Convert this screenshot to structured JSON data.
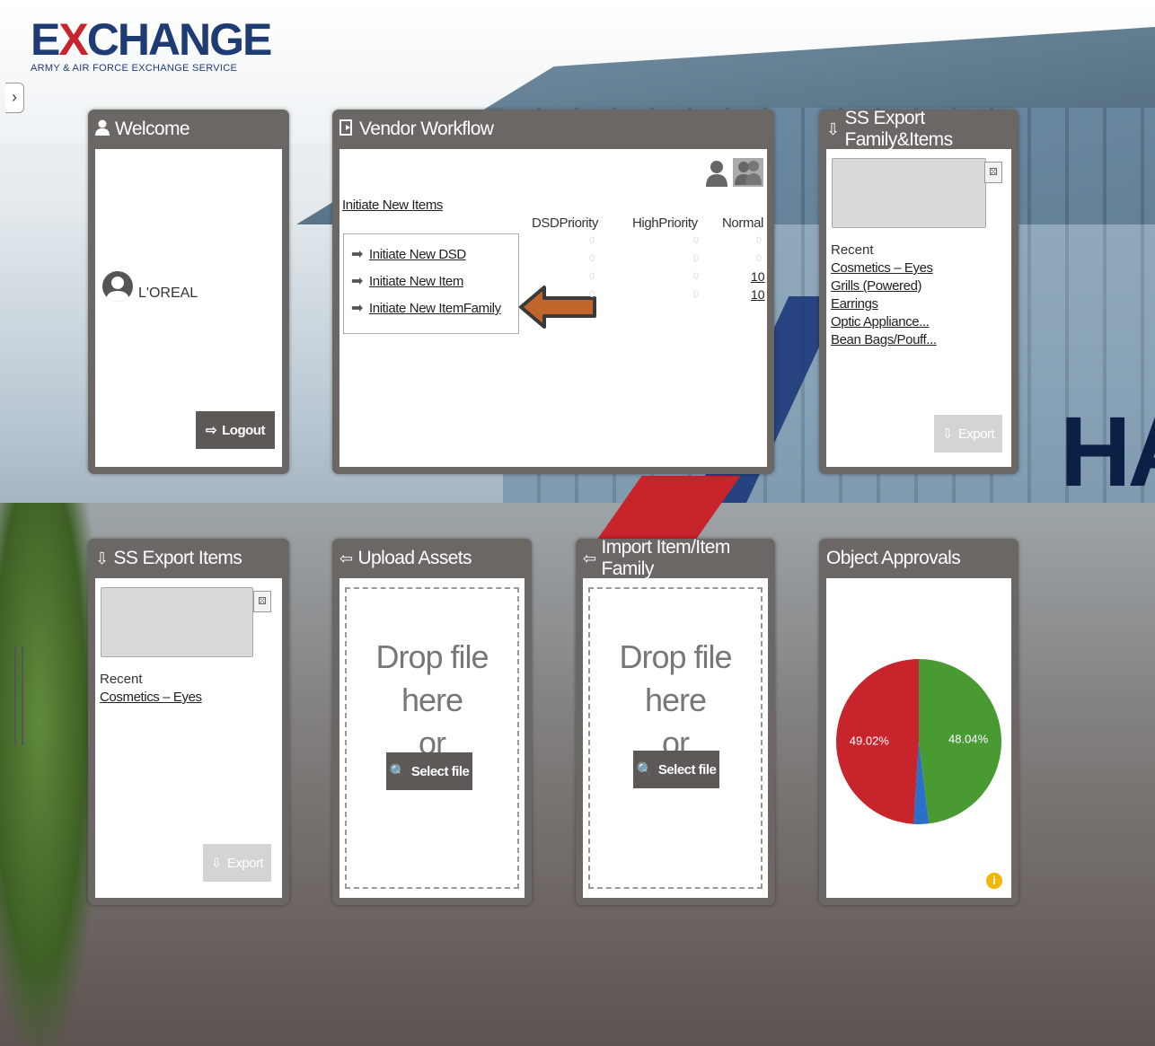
{
  "logo": {
    "title_a": "E",
    "title_x": "X",
    "title_b": "CHANGE",
    "subtitle": "ARMY & AIR FORCE EXCHANGE SERVICE"
  },
  "sidebar_toggle": "›",
  "welcome": {
    "title": "Welcome",
    "user": "L'OREAL",
    "logout": "Logout"
  },
  "workflow": {
    "title": "Vendor Workflow",
    "initiate_label": "Initiate New Items",
    "menu": [
      "Initiate  New  DSD",
      "Initiate  New  Item",
      "Initiate  New  ItemFamily"
    ],
    "columns": [
      "DSDPriority",
      "HighPriority",
      "Normal"
    ],
    "zero": "0",
    "normal_values": [
      "10",
      "10"
    ]
  },
  "ss_family": {
    "title": "SS Export Family&Items",
    "recent_label": "Recent",
    "recent": [
      "Cosmetics – Eyes",
      "Grills (Powered)",
      "Earrings",
      "Optic Appliance...",
      "Bean Bags/Pouff..."
    ],
    "export": "Export"
  },
  "ss_items": {
    "title": "SS Export Items",
    "recent_label": "Recent",
    "recent": [
      "Cosmetics – Eyes"
    ],
    "export": "Export"
  },
  "upload": {
    "title": "Upload Assets",
    "drop1": "Drop file here",
    "drop2": "or",
    "select": "Select file"
  },
  "import": {
    "title": "Import Item/Item Family",
    "drop1": "Drop file here",
    "drop2": "or",
    "select": "Select file"
  },
  "approvals": {
    "title": "Object Approvals",
    "info": "i"
  },
  "chart_data": {
    "type": "pie",
    "title": "",
    "labels": [
      "49.02%",
      "48.04%",
      ""
    ],
    "values": [
      49.02,
      48.04,
      2.94
    ],
    "colors": [
      "#c8242b",
      "#4a9a34",
      "#2a6fc9"
    ]
  },
  "colors": {
    "panel": "#6b6764",
    "accent_arrow": "#c0652b",
    "brand": "#1f3b73"
  }
}
